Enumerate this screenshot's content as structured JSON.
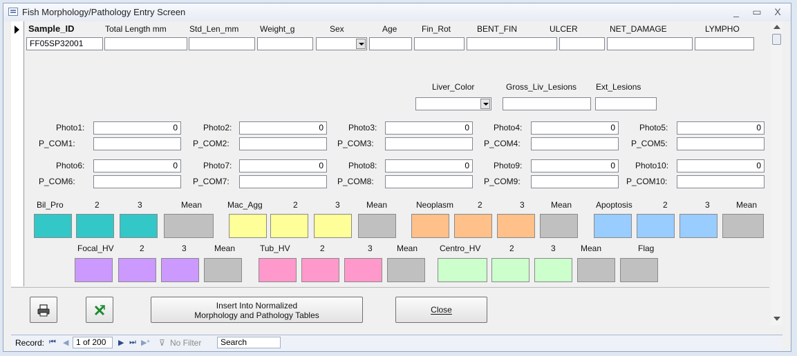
{
  "window": {
    "title": "Fish Morphology/Pathology Entry Screen",
    "minimize": "_",
    "maximize": "▭",
    "close": "X"
  },
  "header_fields": [
    {
      "label": "Sample_ID",
      "value": "FF05SP32001"
    },
    {
      "label": "Total Length mm",
      "value": ""
    },
    {
      "label": "Std_Len_mm",
      "value": ""
    },
    {
      "label": "Weight_g",
      "value": ""
    },
    {
      "label": "Sex",
      "value": ""
    },
    {
      "label": "Age",
      "value": ""
    },
    {
      "label": "Fin_Rot",
      "value": ""
    },
    {
      "label": "BENT_FIN",
      "value": ""
    },
    {
      "label": "ULCER",
      "value": ""
    },
    {
      "label": "NET_DAMAGE",
      "value": ""
    },
    {
      "label": "LYMPHO",
      "value": ""
    }
  ],
  "liver": [
    {
      "label": "Liver_Color",
      "value": ""
    },
    {
      "label": "Gross_Liv_Lesions",
      "value": ""
    },
    {
      "label": "Ext_Lesions",
      "value": ""
    }
  ],
  "photos": [
    {
      "label": "Photo1:",
      "value": "0",
      "com_label": "P_COM1:",
      "com": ""
    },
    {
      "label": "Photo2:",
      "value": "0",
      "com_label": "P_COM2:",
      "com": ""
    },
    {
      "label": "Photo3:",
      "value": "0",
      "com_label": "P_COM3:",
      "com": ""
    },
    {
      "label": "Photo4:",
      "value": "0",
      "com_label": "P_COM4:",
      "com": ""
    },
    {
      "label": "Photo5:",
      "value": "0",
      "com_label": "P_COM5:",
      "com": ""
    },
    {
      "label": "Photo6:",
      "value": "0",
      "com_label": "P_COM6:",
      "com": ""
    },
    {
      "label": "Photo7:",
      "value": "0",
      "com_label": "P_COM7:",
      "com": ""
    },
    {
      "label": "Photo8:",
      "value": "0",
      "com_label": "P_COM8:",
      "com": ""
    },
    {
      "label": "Photo9:",
      "value": "0",
      "com_label": "P_COM9:",
      "com": ""
    },
    {
      "label": "Photo10:",
      "value": "0",
      "com_label": "P_COM10:",
      "com": ""
    }
  ],
  "groups_row1": [
    {
      "name": "Bil_Pro",
      "c2": "2",
      "c3": "3",
      "mean": "Mean",
      "color": "#33c7c7"
    },
    {
      "name": "Mac_Agg",
      "c2": "2",
      "c3": "3",
      "mean": "Mean",
      "color": "#ffff99"
    },
    {
      "name": "Neoplasm",
      "c2": "2",
      "c3": "3",
      "mean": "Mean",
      "color": "#ffc08a"
    },
    {
      "name": "Apoptosis",
      "c2": "2",
      "c3": "3",
      "mean": "Mean",
      "color": "#99ccff"
    }
  ],
  "groups_row2": [
    {
      "name": "Focal_HV",
      "c2": "2",
      "c3": "3",
      "mean": "Mean",
      "color": "#cc99ff"
    },
    {
      "name": "Tub_HV",
      "c2": "2",
      "c3": "3",
      "mean": "Mean",
      "color": "#ff99cc"
    },
    {
      "name": "Centro_HV",
      "c2": "2",
      "c3": "3",
      "mean": "Mean",
      "color": "#ccffcc"
    }
  ],
  "flag": {
    "label": "Flag"
  },
  "mean_color": "#c0c0c0",
  "buttons": {
    "insert": "Insert Into Normalized Morphology and Pathology Tables",
    "insert_line1": "Insert Into Normalized",
    "insert_line2": "Morphology and Pathology Tables",
    "close": "Close"
  },
  "icons": {
    "print": "printer-icon",
    "excel": "excel-export-icon"
  },
  "navigation": {
    "record_label": "Record:",
    "position": "1 of 200",
    "filter": "No Filter",
    "search": "Search"
  }
}
